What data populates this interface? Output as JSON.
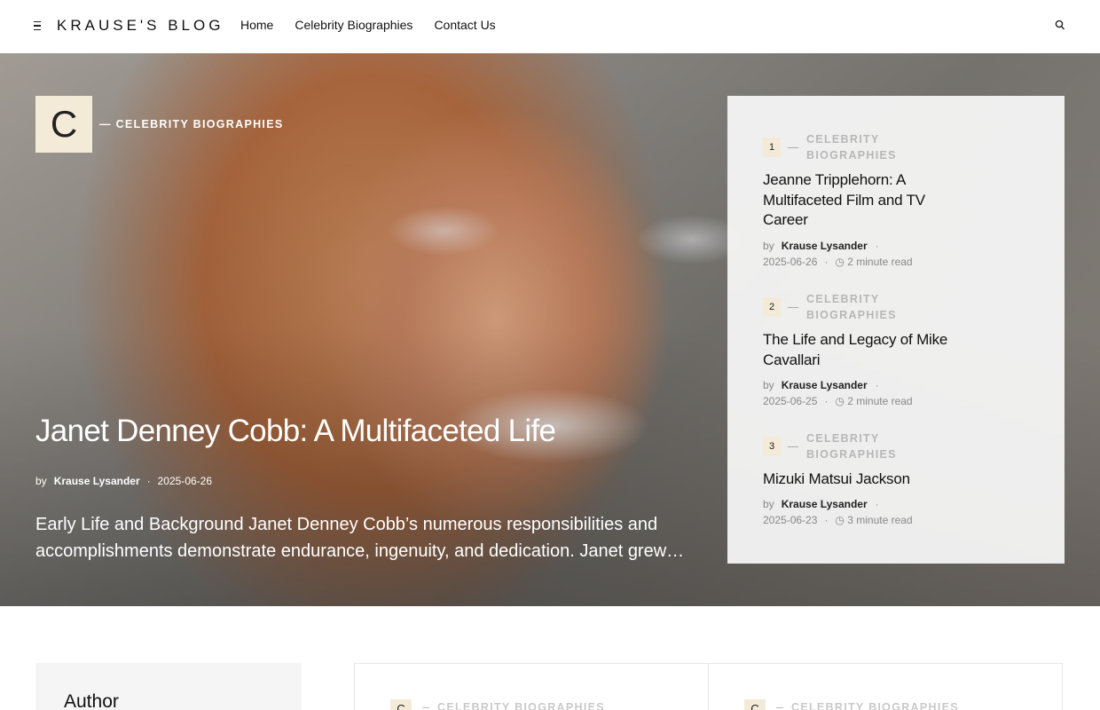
{
  "header": {
    "logo": "KRAUSE'S BLOG",
    "nav": [
      "Home",
      "Celebrity Biographies",
      "Contact Us"
    ]
  },
  "hero": {
    "category_letter": "C",
    "category": "— CELEBRITY BIOGRAPHIES",
    "title": "Janet Denney Cobb: A Multifaceted Life",
    "by": "by",
    "author": "Krause Lysander",
    "date": "2025-06-26",
    "excerpt": "Early Life and Background Janet Denney Cobb’s numerous responsibilities and accomplishments demonstrate endurance, ingenuity, and dedication. Janet grew…"
  },
  "trending": [
    {
      "num": "1",
      "category": "CELEBRITY BIOGRAPHIES",
      "title": "Jeanne Tripplehorn: A Multifaceted Film and TV Career",
      "by": "by",
      "author": "Krause Lysander",
      "date": "2025-06-26",
      "read": "2 minute read"
    },
    {
      "num": "2",
      "category": "CELEBRITY BIOGRAPHIES",
      "title": "The Life and Legacy of Mike Cavallari",
      "by": "by",
      "author": "Krause Lysander",
      "date": "2025-06-25",
      "read": "2 minute read"
    },
    {
      "num": "3",
      "category": "CELEBRITY BIOGRAPHIES",
      "title": "Mizuki Matsui Jackson",
      "by": "by",
      "author": "Krause Lysander",
      "date": "2025-06-23",
      "read": "3 minute read"
    }
  ],
  "sidebar": {
    "title": "Author"
  },
  "cards": [
    {
      "letter": "C",
      "category": "CELEBRITY BIOGRAPHIES"
    },
    {
      "letter": "C",
      "category": "CELEBRITY BIOGRAPHIES"
    }
  ],
  "colors": {
    "accent_tag": "#f4ead8",
    "panel": "#fafafa"
  },
  "icons": {
    "menu": "hamburger-icon",
    "search": "search-icon",
    "clock": "clock-icon"
  }
}
